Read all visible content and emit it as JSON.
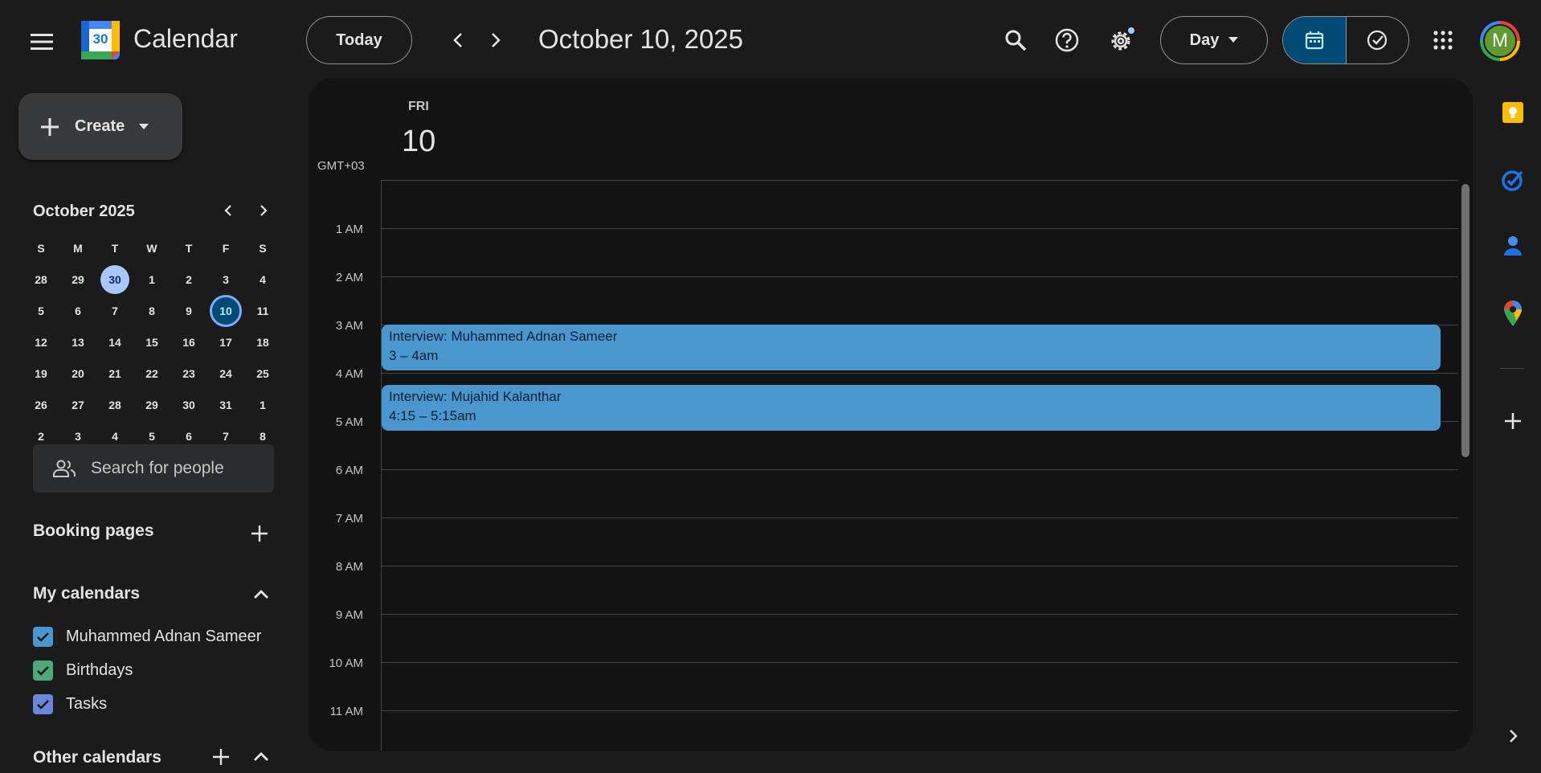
{
  "header": {
    "app_title": "Calendar",
    "logo_day": "30",
    "today_label": "Today",
    "current_date": "October 10, 2025",
    "view_label": "Day",
    "avatar_initial": "M"
  },
  "sidebar": {
    "create_label": "Create",
    "mini_month": "October 2025",
    "weekdays": [
      "S",
      "M",
      "T",
      "W",
      "T",
      "F",
      "S"
    ],
    "weeks": [
      [
        "28",
        "29",
        "30",
        "1",
        "2",
        "3",
        "4"
      ],
      [
        "5",
        "6",
        "7",
        "8",
        "9",
        "10",
        "11"
      ],
      [
        "12",
        "13",
        "14",
        "15",
        "16",
        "17",
        "18"
      ],
      [
        "19",
        "20",
        "21",
        "22",
        "23",
        "24",
        "25"
      ],
      [
        "26",
        "27",
        "28",
        "29",
        "30",
        "31",
        "1"
      ],
      [
        "2",
        "3",
        "4",
        "5",
        "6",
        "7",
        "8"
      ]
    ],
    "search_placeholder": "Search for people",
    "booking_pages": "Booking pages",
    "my_calendars": "My calendars",
    "calendars": [
      {
        "label": "Muhammed Adnan Sameer",
        "color": "#4a97d0"
      },
      {
        "label": "Birthdays",
        "color": "#4ea87a"
      },
      {
        "label": "Tasks",
        "color": "#6a86d8"
      }
    ],
    "other_calendars": "Other calendars"
  },
  "main": {
    "day_name": "FRI",
    "day_number": "10",
    "timezone": "GMT+03",
    "hours": [
      "1 AM",
      "2 AM",
      "3 AM",
      "4 AM",
      "5 AM",
      "6 AM",
      "7 AM",
      "8 AM",
      "9 AM",
      "10 AM",
      "11 AM"
    ],
    "events": [
      {
        "title": "Interview: Muhammed Adnan Sameer",
        "time": "3 – 4am",
        "color": "#4a97d0"
      },
      {
        "title": "Interview: Mujahid Kalanthar",
        "time": "4:15 – 5:15am",
        "color": "#4a97d0"
      }
    ]
  },
  "colors": {
    "background": "#1b1b1b",
    "surface": "#131313",
    "accent": "#004a77",
    "event": "#4a97d0"
  }
}
